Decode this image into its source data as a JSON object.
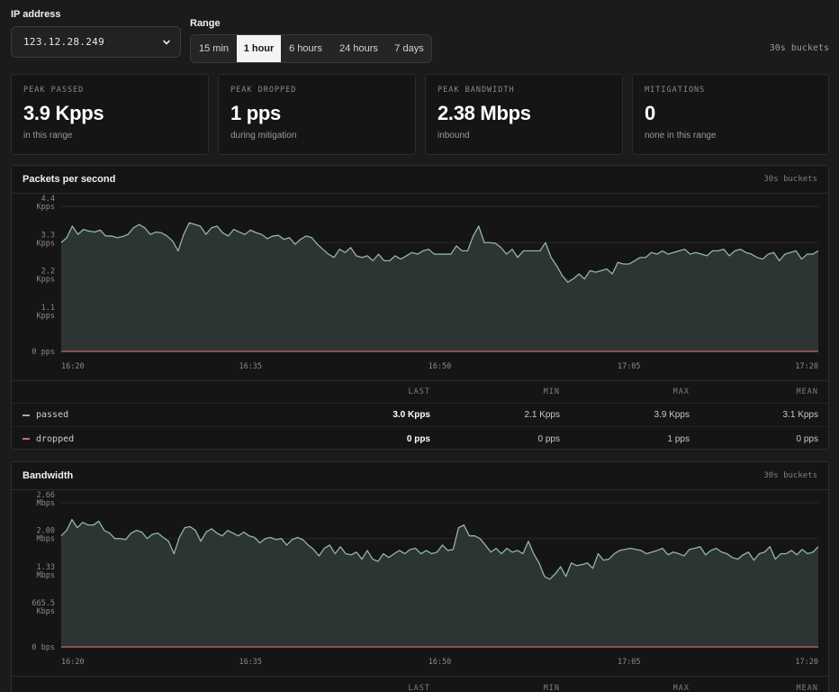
{
  "ip": {
    "label": "IP address",
    "selected": "123.12.28.249"
  },
  "range": {
    "label": "Range",
    "options": [
      "15 min",
      "1 hour",
      "6 hours",
      "24 hours",
      "7 days"
    ],
    "active": "1 hour"
  },
  "buckets_label": "30s buckets",
  "stats": [
    {
      "label": "PEAK PASSED",
      "value": "3.9 Kpps",
      "sub": "in this range"
    },
    {
      "label": "PEAK DROPPED",
      "value": "1 pps",
      "sub": "during mitigation"
    },
    {
      "label": "PEAK BANDWIDTH",
      "value": "2.38 Mbps",
      "sub": "inbound"
    },
    {
      "label": "MITIGATIONS",
      "value": "0",
      "sub": "none in this range"
    }
  ],
  "colors": {
    "passed": "#93b4aa",
    "dropped": "#c86b6b",
    "area": "#2c3533",
    "accent": "#f4f4f2"
  },
  "pps_chart": {
    "title": "Packets per second",
    "buckets": "30s buckets",
    "stat_headers": [
      "LAST",
      "MIN",
      "MAX",
      "MEAN"
    ],
    "rows": [
      {
        "name": "passed",
        "color": "#93b4aa",
        "last": "3.0 Kpps",
        "min": "2.1 Kpps",
        "max": "3.9 Kpps",
        "mean": "3.1 Kpps"
      },
      {
        "name": "dropped",
        "color": "#c86b6b",
        "last": "0 pps",
        "min": "0 pps",
        "max": "1 pps",
        "mean": "0 pps"
      }
    ]
  },
  "bw_chart": {
    "title": "Bandwidth",
    "buckets": "30s buckets",
    "stat_headers": [
      "LAST",
      "MIN",
      "MAX",
      "MEAN"
    ]
  },
  "chart_data": [
    {
      "type": "area",
      "title": "Packets per second",
      "x_ticks": [
        "16:20",
        "16:35",
        "16:50",
        "17:05",
        "17:20"
      ],
      "y_ticks": [
        {
          "value": 4.4,
          "label": [
            "4.4",
            "Kpps"
          ]
        },
        {
          "value": 3.3,
          "label": [
            "3.3",
            "Kpps"
          ]
        },
        {
          "value": 2.2,
          "label": [
            "2.2",
            "Kpps"
          ]
        },
        {
          "value": 1.1,
          "label": [
            "1.1",
            "Kpps"
          ]
        },
        {
          "value": 0,
          "label": [
            "0 pps"
          ]
        }
      ],
      "ylim": [
        0,
        4.4
      ],
      "unit": "Kpps",
      "series": [
        {
          "name": "passed",
          "values": [
            3.3,
            3.45,
            3.8,
            3.55,
            3.7,
            3.65,
            3.62,
            3.68,
            3.5,
            3.5,
            3.45,
            3.48,
            3.55,
            3.75,
            3.85,
            3.75,
            3.55,
            3.62,
            3.6,
            3.5,
            3.35,
            3.05,
            3.55,
            3.9,
            3.85,
            3.8,
            3.55,
            3.75,
            3.8,
            3.6,
            3.5,
            3.7,
            3.62,
            3.55,
            3.68,
            3.6,
            3.55,
            3.42,
            3.5,
            3.52,
            3.4,
            3.45,
            3.25,
            3.4,
            3.5,
            3.45,
            3.25,
            3.1,
            2.95,
            2.85,
            3.1,
            3.0,
            3.15,
            2.9,
            2.85,
            2.9,
            2.75,
            2.95,
            2.75,
            2.75,
            2.9,
            2.8,
            2.9,
            3.0,
            2.95,
            3.05,
            3.1,
            2.95,
            2.95,
            2.95,
            2.95,
            3.2,
            3.05,
            3.05,
            3.5,
            3.8,
            3.3,
            3.3,
            3.28,
            3.15,
            2.95,
            3.1,
            2.85,
            3.05,
            3.05,
            3.05,
            3.05,
            3.3,
            2.85,
            2.6,
            2.3,
            2.1,
            2.2,
            2.35,
            2.2,
            2.45,
            2.4,
            2.45,
            2.5,
            2.35,
            2.7,
            2.65,
            2.65,
            2.75,
            2.85,
            2.85,
            3.0,
            2.95,
            3.05,
            2.95,
            3.0,
            3.05,
            3.1,
            2.95,
            3.0,
            2.95,
            2.9,
            3.05,
            3.05,
            3.1,
            2.9,
            3.05,
            3.1,
            3.0,
            2.95,
            2.85,
            2.8,
            2.95,
            3.0,
            2.75,
            2.95,
            3.0,
            3.05,
            2.8,
            2.95,
            2.95,
            3.05
          ]
        },
        {
          "name": "dropped",
          "values": [
            0,
            0
          ]
        }
      ]
    },
    {
      "type": "area",
      "title": "Bandwidth",
      "x_ticks": [
        "16:20",
        "16:35",
        "16:50",
        "17:05",
        "17:20"
      ],
      "y_ticks": [
        {
          "value": 2.66,
          "label": [
            "2.66",
            "Mbps"
          ]
        },
        {
          "value": 2.0,
          "label": [
            "2.00",
            "Mbps"
          ]
        },
        {
          "value": 1.33,
          "label": [
            "1.33",
            "Mbps"
          ]
        },
        {
          "value": 0.6655,
          "label": [
            "665.5",
            "Kbps"
          ]
        },
        {
          "value": 0,
          "label": [
            "0 bps"
          ]
        }
      ],
      "ylim": [
        0,
        2.66
      ],
      "unit": "Mbps",
      "series": [
        {
          "name": "passed",
          "values": [
            2.05,
            2.15,
            2.35,
            2.2,
            2.3,
            2.25,
            2.25,
            2.32,
            2.15,
            2.1,
            2.0,
            2.0,
            1.98,
            2.1,
            2.15,
            2.12,
            2.0,
            2.08,
            2.1,
            2.02,
            1.95,
            1.72,
            2.02,
            2.2,
            2.22,
            2.15,
            1.95,
            2.12,
            2.18,
            2.1,
            2.05,
            2.15,
            2.1,
            2.05,
            2.12,
            2.05,
            2.02,
            1.92,
            2.0,
            2.02,
            1.98,
            2.0,
            1.88,
            1.98,
            2.02,
            1.98,
            1.88,
            1.8,
            1.68,
            1.82,
            1.88,
            1.72,
            1.85,
            1.72,
            1.7,
            1.75,
            1.62,
            1.78,
            1.62,
            1.58,
            1.72,
            1.65,
            1.72,
            1.78,
            1.72,
            1.8,
            1.82,
            1.72,
            1.78,
            1.72,
            1.75,
            1.88,
            1.78,
            1.8,
            2.2,
            2.25,
            2.05,
            2.05,
            2.0,
            1.88,
            1.75,
            1.82,
            1.72,
            1.82,
            1.75,
            1.78,
            1.72,
            1.95,
            1.72,
            1.55,
            1.3,
            1.25,
            1.35,
            1.48,
            1.3,
            1.55,
            1.5,
            1.52,
            1.55,
            1.45,
            1.72,
            1.6,
            1.62,
            1.72,
            1.78,
            1.8,
            1.82,
            1.8,
            1.78,
            1.72,
            1.75,
            1.78,
            1.82,
            1.7,
            1.75,
            1.72,
            1.68,
            1.8,
            1.82,
            1.85,
            1.7,
            1.78,
            1.82,
            1.75,
            1.72,
            1.65,
            1.62,
            1.7,
            1.75,
            1.6,
            1.72,
            1.75,
            1.85,
            1.62,
            1.72,
            1.72,
            1.78,
            1.7,
            1.8,
            1.72,
            1.75,
            1.85
          ]
        },
        {
          "name": "dropped",
          "values": [
            0,
            0
          ]
        }
      ]
    }
  ]
}
